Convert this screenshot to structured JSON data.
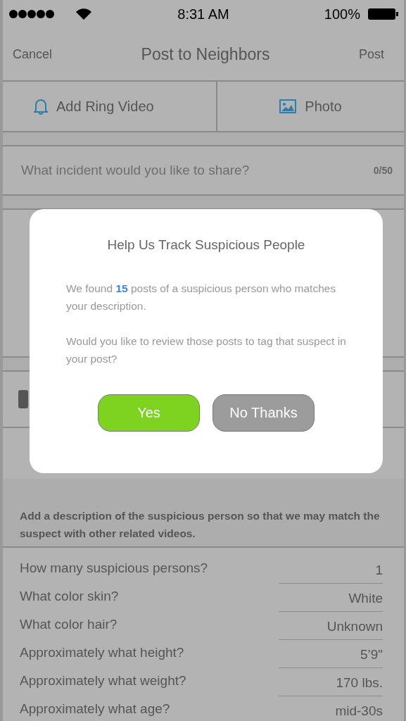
{
  "status_bar": {
    "time": "8:31 AM",
    "battery": "100%"
  },
  "nav": {
    "cancel": "Cancel",
    "title": "Post to Neighbors",
    "post": "Post"
  },
  "attach_buttons": [
    {
      "kind": "bell",
      "label": "Add Ring Video"
    },
    {
      "kind": "image",
      "label": "Photo"
    }
  ],
  "incident_field": {
    "placeholder": "What incident would you like to share?",
    "counter": "0/50"
  },
  "dialog": {
    "title": "Help Us Track Suspicious People",
    "message": "We found **15** posts of a suspicious person who matches your description.",
    "question": "Would you like to review those posts to tag that suspect in your post?",
    "buttons": [
      {
        "kind": "primary",
        "label": "Yes"
      },
      {
        "kind": "secondary",
        "label": "No Thanks"
      }
    ]
  },
  "suspect_intro": "Add a description of the suspicious person so that we may match the suspect with other related videos.",
  "suspect_fields": [
    {
      "label": "How many suspicious persons?",
      "value": "1"
    },
    {
      "label": "What color skin?",
      "value": "White"
    },
    {
      "label": "What color hair?",
      "value": "Unknown"
    },
    {
      "label": "Approximately what height?",
      "value": "5’9\""
    },
    {
      "label": "Approximately what weight?",
      "value": "170 lbs."
    },
    {
      "label": "Approximately what age?",
      "value": "mid-30s"
    }
  ]
}
